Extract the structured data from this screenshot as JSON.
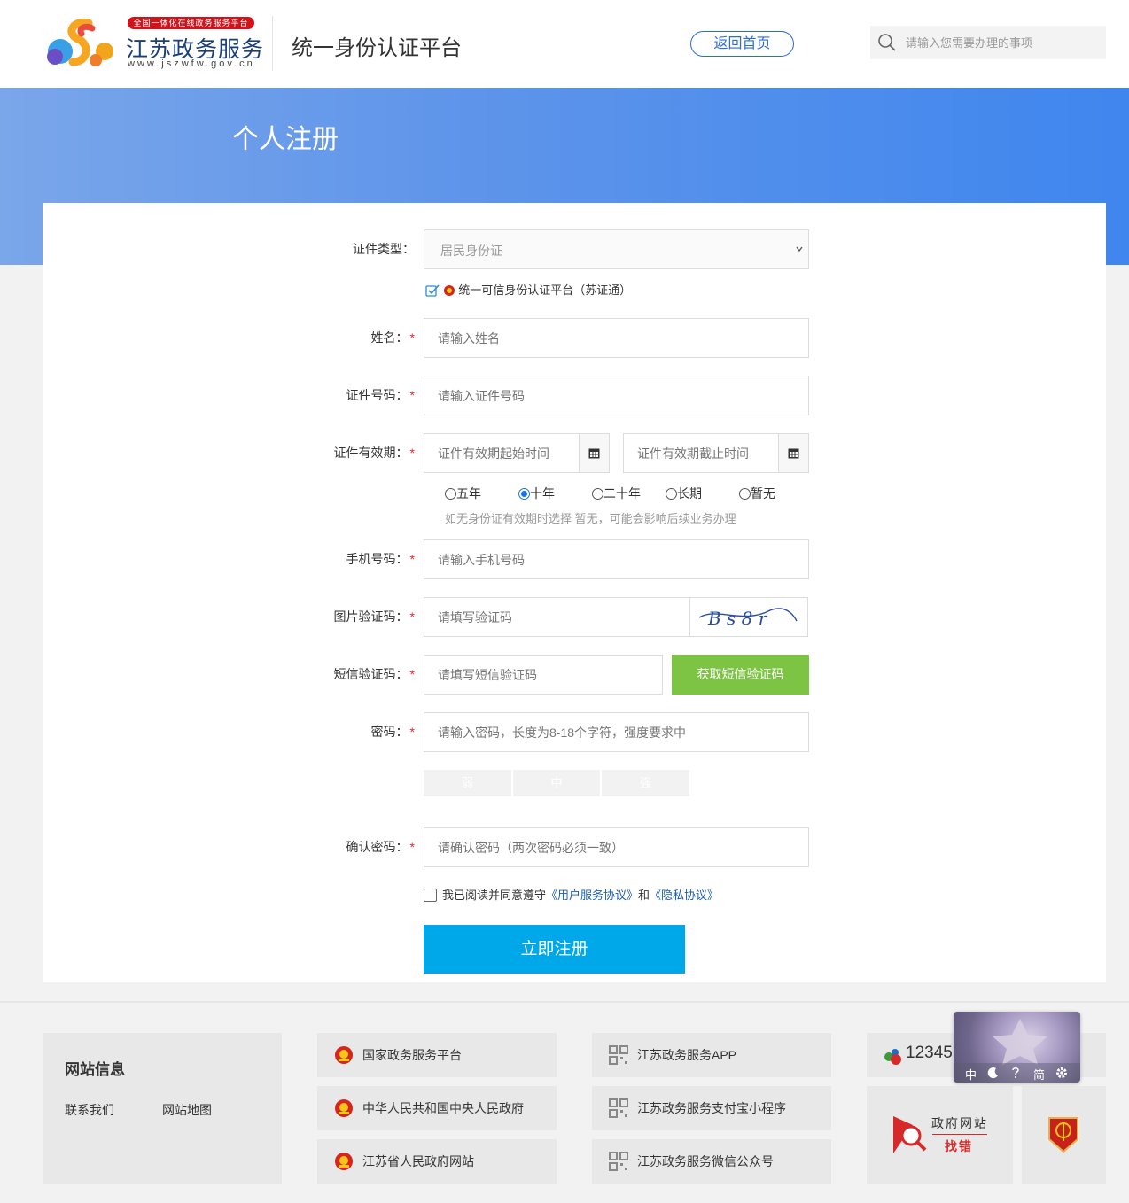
{
  "header": {
    "logo_badge": "全国一体化在线政务服务平台",
    "logo_name": "江苏政务服务",
    "logo_url": "www.jszwfw.gov.cn",
    "platform_title": "统一身份认证平台",
    "home_button": "返回首页",
    "search_placeholder": "请输入您需要办理的事项"
  },
  "banner": {
    "title": "个人注册"
  },
  "form": {
    "cert_type": {
      "label": "证件类型：",
      "value": "居民身份证"
    },
    "cert_platform": "统一可信身份认证平台（苏证通）",
    "name": {
      "label": "姓名：",
      "placeholder": "请输入姓名"
    },
    "cert_number": {
      "label": "证件号码：",
      "placeholder": "请输入证件号码"
    },
    "validity": {
      "label": "证件有效期：",
      "start_placeholder": "证件有效期起始时间",
      "end_placeholder": "证件有效期截止时间",
      "options": [
        "五年",
        "十年",
        "二十年",
        "长期",
        "暂无"
      ],
      "selected": "十年",
      "hint": "如无身份证有效期时选择 暂无，可能会影响后续业务办理"
    },
    "phone": {
      "label": "手机号码：",
      "placeholder": "请输入手机号码"
    },
    "captcha": {
      "label": "图片验证码：",
      "placeholder": "请填写验证码",
      "image_text": "B s 8 r"
    },
    "sms": {
      "label": "短信验证码：",
      "placeholder": "请填写短信验证码",
      "button": "获取短信验证码"
    },
    "password": {
      "label": "密码：",
      "placeholder": "请输入密码，长度为8-18个字符，强度要求中",
      "strength": [
        "弱",
        "中",
        "强"
      ]
    },
    "confirm_password": {
      "label": "确认密码：",
      "placeholder": "请确认密码（两次密码必须一致）"
    },
    "agreement": {
      "prefix": "我已阅读并同意遵守",
      "user_agreement": "《用户服务协议》",
      "and": "和",
      "privacy": "《隐私协议》"
    },
    "required_mark": "*",
    "submit": "立即注册"
  },
  "footer": {
    "site_info_title": "网站信息",
    "contact": "联系我们",
    "sitemap": "网站地图",
    "links_col1": [
      "国家政务服务平台",
      "中华人民共和国中央人民政府",
      "江苏省人民政府网站"
    ],
    "links_col2": [
      "江苏政务服务APP",
      "江苏政务服务支付宝小程序",
      "江苏政务服务微信公众号"
    ],
    "hotline": "12345",
    "error_report_title": "政府网站",
    "error_report_sub": "找错"
  },
  "widget": {
    "items": [
      "中",
      "简"
    ]
  },
  "colors": {
    "brand_blue": "#2b6be0",
    "submit_blue": "#00a8ea",
    "sms_green": "#7dc445",
    "required_red": "#e8242c"
  }
}
